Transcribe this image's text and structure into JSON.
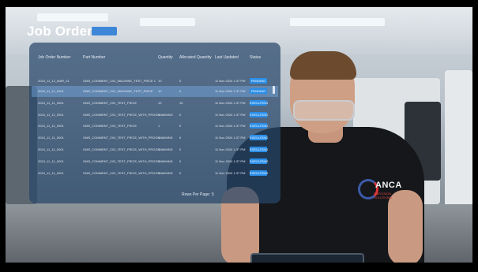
{
  "header": {
    "title": "Job Orders",
    "badge_label": "",
    "accent": "#3d86d8"
  },
  "table": {
    "columns": [
      "Job Order Number",
      "Part Number",
      "Quantity",
      "Allocated Quantity",
      "Last Updated",
      "Status"
    ],
    "rows": [
      {
        "job": "2024_11_12_MAR_01",
        "part": "GMS_COMMENT_2X2_MACHINE_TEST_PIECE 1",
        "qty": "10",
        "alloc": "0",
        "updated": "11 Nov 2024 1:37 PM",
        "status": "PENDING"
      },
      {
        "job": "2024_11_11_0001",
        "part": "GMS_COMMENT_2X2_MACHINE_TEST_PIECE",
        "qty": "10",
        "alloc": "0",
        "updated": "11 Nov 2024 1:37 PM",
        "status": "PENDING"
      },
      {
        "job": "2024_11_11_0001",
        "part": "GMS_COMMENT_2X2_TEST_PIECE",
        "qty": "10",
        "alloc": "10",
        "updated": "11 Nov 2024 1:37 PM",
        "status": "EXECUTING"
      },
      {
        "job": "2024_11_11_0001",
        "part": "GMS_COMMENT_2X2_TEST_PIECE_WITH_PROGRAMMING",
        "qty": "1",
        "alloc": "0",
        "updated": "11 Nov 2024 1:37 PM",
        "status": "EXECUTING"
      },
      {
        "job": "2024_11_11_0001",
        "part": "GMS_COMMENT_2X2_TEST_PIECE",
        "qty": "1",
        "alloc": "0",
        "updated": "11 Nov 2024 1:37 PM",
        "status": "EXECUTING"
      },
      {
        "job": "2024_11_11_0001",
        "part": "GMS_COMMENT_2X2_TEST_PIECE_WITH_PROGRAMMING",
        "qty": "1",
        "alloc": "0",
        "updated": "11 Nov 2024 1:37 PM",
        "status": "EXECUTING"
      },
      {
        "job": "2024_11_11_0001",
        "part": "GMS_COMMENT_2X2_TEST_PIECE_WITH_PROGRAMMING",
        "qty": "1",
        "alloc": "0",
        "updated": "11 Nov 2024 1:37 PM",
        "status": "EXECUTING"
      },
      {
        "job": "2024_11_11_0001",
        "part": "GMS_COMMENT_2X2_TEST_PIECE_WITH_PROGRAMMING",
        "qty": "1",
        "alloc": "0",
        "updated": "11 Nov 2024 1:37 PM",
        "status": "EXECUTING"
      },
      {
        "job": "2024_11_11_0001",
        "part": "GMS_COMMENT_2X2_TEST_PIECE_WITH_PROGRAMMING",
        "qty": "1",
        "alloc": "0",
        "updated": "11 Nov 2024 1:37 PM",
        "status": "EXECUTING"
      }
    ],
    "selected_row": 1,
    "rows_per_page_label": "Rows Per Page:",
    "rows_per_page_value": "5",
    "status_color": "#2a8ee8"
  },
  "brand": {
    "logo_text": "ANCA",
    "logo_subtext": "PRECISION SOLUTIONS"
  }
}
